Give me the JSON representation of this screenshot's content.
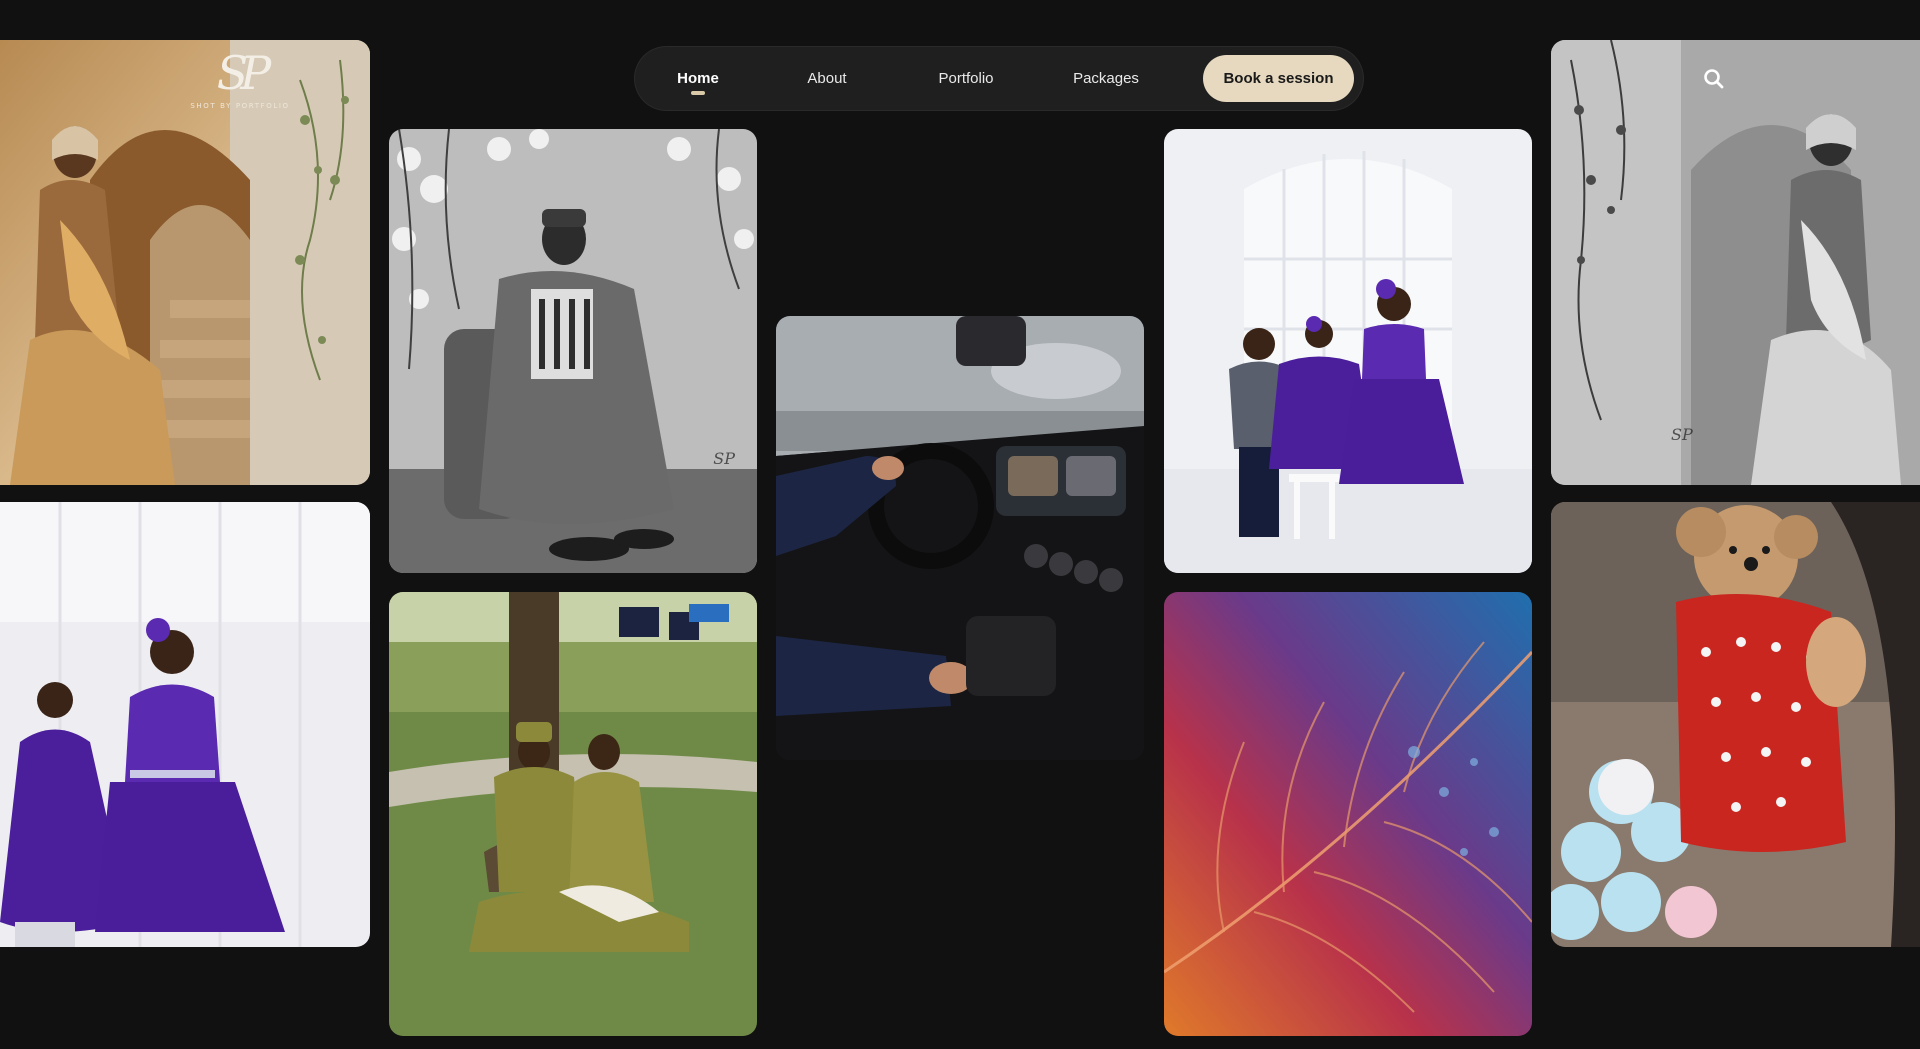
{
  "brand": {
    "logo_mark": "SP",
    "logo_sub": "SHOT BY PORTFOLIO"
  },
  "nav": {
    "items": [
      {
        "label": "Home",
        "active": true
      },
      {
        "label": "About",
        "active": false
      },
      {
        "label": "Portfolio",
        "active": false
      },
      {
        "label": "Packages",
        "active": false
      }
    ],
    "cta_label": "Book a session"
  },
  "icons": {
    "search": "search-icon"
  },
  "colors": {
    "background": "#111111",
    "nav_bg": "#1f1f1f",
    "cta_bg": "#e6d9bf",
    "accent": "#d9c9a9"
  },
  "gallery": [
    {
      "name": "woman-gold-gown-photo"
    },
    {
      "name": "girls-purple-dresses-photo"
    },
    {
      "name": "man-seated-bw-photo"
    },
    {
      "name": "couple-park-photo"
    },
    {
      "name": "car-interior-photo"
    },
    {
      "name": "children-purple-outfits-photo"
    },
    {
      "name": "leaf-macro-photo"
    },
    {
      "name": "woman-gown-bw-photo"
    },
    {
      "name": "puppy-sweater-photo"
    }
  ]
}
